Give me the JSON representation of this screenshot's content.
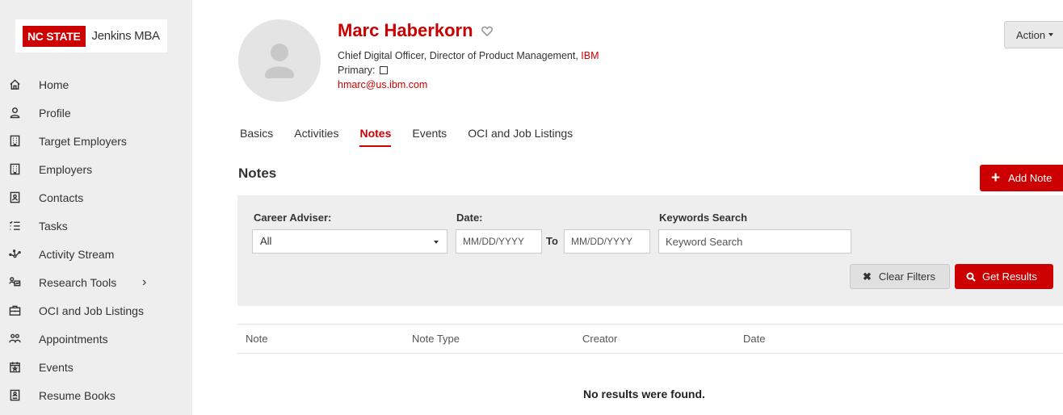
{
  "sidebar": {
    "logo_badge": "NC STATE",
    "logo_text": "Jenkins MBA",
    "items": [
      {
        "label": "Home",
        "icon": "home-icon"
      },
      {
        "label": "Profile",
        "icon": "user-icon"
      },
      {
        "label": "Target Employers",
        "icon": "building-icon"
      },
      {
        "label": "Employers",
        "icon": "building-icon"
      },
      {
        "label": "Contacts",
        "icon": "contact-card-icon"
      },
      {
        "label": "Tasks",
        "icon": "checklist-icon"
      },
      {
        "label": "Activity Stream",
        "icon": "network-icon"
      },
      {
        "label": "Research Tools",
        "icon": "research-icon",
        "chevron": "›"
      },
      {
        "label": "OCI and Job Listings",
        "icon": "briefcase-icon"
      },
      {
        "label": "Appointments",
        "icon": "people-icon"
      },
      {
        "label": "Events",
        "icon": "calendar-star-icon"
      },
      {
        "label": "Resume Books",
        "icon": "resume-book-icon"
      }
    ]
  },
  "profile": {
    "name": "Marc Haberkorn",
    "title_prefix": "Chief Digital Officer, Director of Product Management, ",
    "company": "IBM",
    "primary_label": "Primary:",
    "email": "hmarc@us.ibm.com",
    "action_label": "Action"
  },
  "tabs": [
    {
      "label": "Basics",
      "active": false
    },
    {
      "label": "Activities",
      "active": false
    },
    {
      "label": "Notes",
      "active": true
    },
    {
      "label": "Events",
      "active": false
    },
    {
      "label": "OCI and Job Listings",
      "active": false
    }
  ],
  "notes": {
    "section_title": "Notes",
    "add_label": "Add Note",
    "filters": {
      "adviser_label": "Career Adviser:",
      "adviser_value": "All",
      "date_label": "Date:",
      "date_from_placeholder": "MM/DD/YYYY",
      "to_label": "To",
      "date_to_placeholder": "MM/DD/YYYY",
      "keywords_label": "Keywords Search",
      "keywords_placeholder": "Keyword Search",
      "clear_label": "Clear Filters",
      "results_label": "Get Results"
    },
    "table": {
      "columns": [
        "Note",
        "Note Type",
        "Creator",
        "Date"
      ],
      "empty_message": "No results were found."
    }
  },
  "colors": {
    "brand_red": "#cc0000",
    "sidebar_bg": "#eeeeee"
  }
}
